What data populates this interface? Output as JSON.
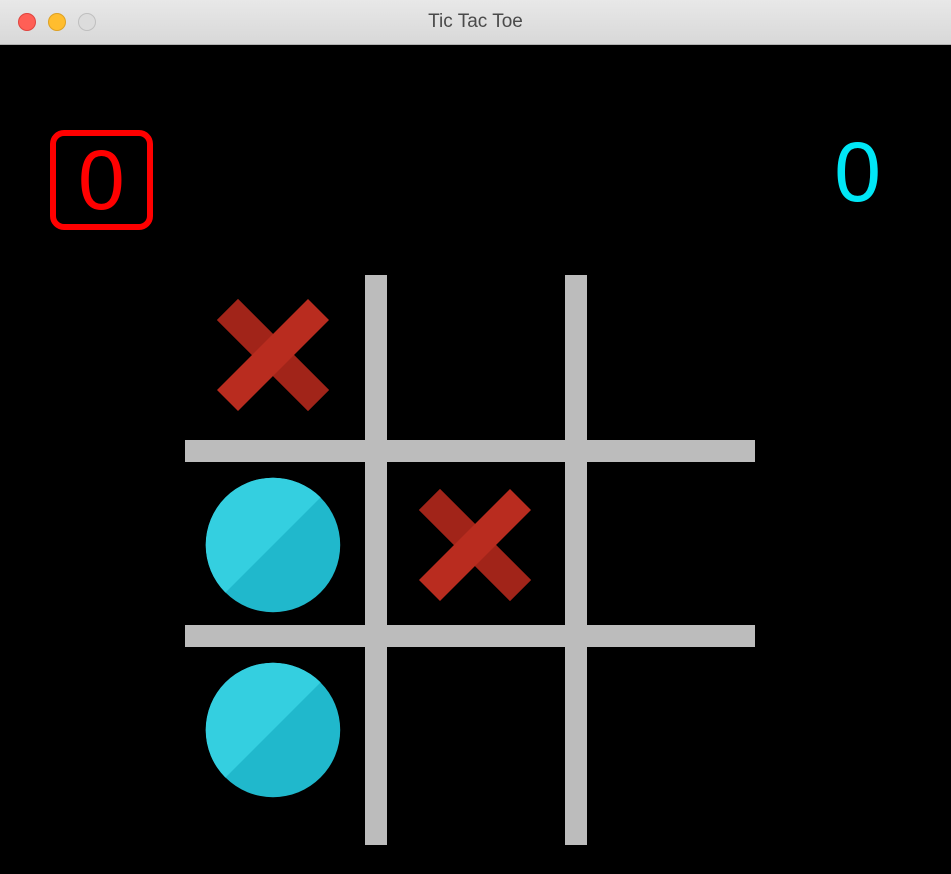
{
  "window": {
    "title": "Tic Tac Toe"
  },
  "scores": {
    "x": "0",
    "o": "0",
    "active_player": "x"
  },
  "colors": {
    "x_mark": "#b92c1f",
    "x_mark_shadow": "#a12419",
    "o_mark": "#20b8cc",
    "o_mark_highlight": "#34cfe0",
    "score_x": "#ff0000",
    "score_o": "#00e7f6",
    "grid": "#bcbcbc",
    "background": "#000000"
  },
  "board": {
    "cells": [
      [
        "X",
        "",
        ""
      ],
      [
        "O",
        "X",
        ""
      ],
      [
        "O",
        "",
        ""
      ]
    ]
  }
}
